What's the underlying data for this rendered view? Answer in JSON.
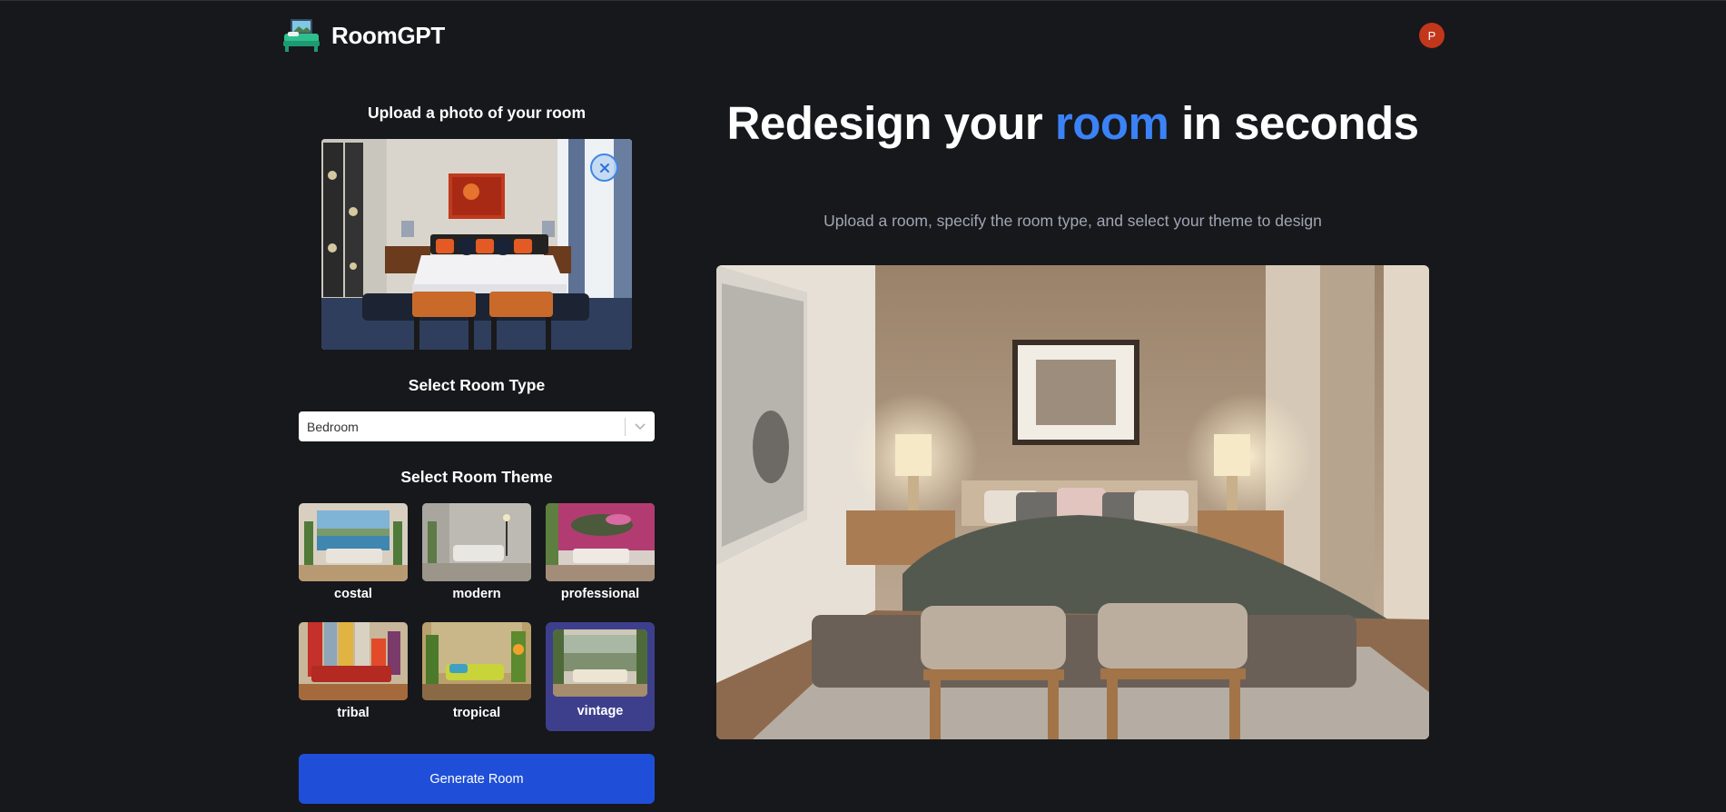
{
  "app": {
    "name": "RoomGPT",
    "user_initial": "P"
  },
  "upload": {
    "title": "Upload a photo of your room"
  },
  "room_type": {
    "title": "Select Room Type",
    "selected": "Bedroom"
  },
  "room_theme": {
    "title": "Select Room Theme",
    "themes": [
      {
        "label": "costal",
        "selected": false
      },
      {
        "label": "modern",
        "selected": false
      },
      {
        "label": "professional",
        "selected": false
      },
      {
        "label": "tribal",
        "selected": false
      },
      {
        "label": "tropical",
        "selected": false
      },
      {
        "label": "vintage",
        "selected": true
      }
    ]
  },
  "actions": {
    "generate_label": "Generate Room"
  },
  "hero": {
    "title_part1": "Redesign your ",
    "title_accent": "room",
    "title_part2": " in seconds",
    "subtitle": "Upload a room, specify the room type, and select your theme to design"
  },
  "colors": {
    "background": "#17181c",
    "accent": "#3b82f6",
    "button": "#1f4fd8",
    "selected_theme": "#3d3f8c",
    "avatar": "#c2361b"
  },
  "icons": {
    "logo": "bed-icon",
    "remove": "close-icon",
    "dropdown": "chevron-down-icon"
  }
}
